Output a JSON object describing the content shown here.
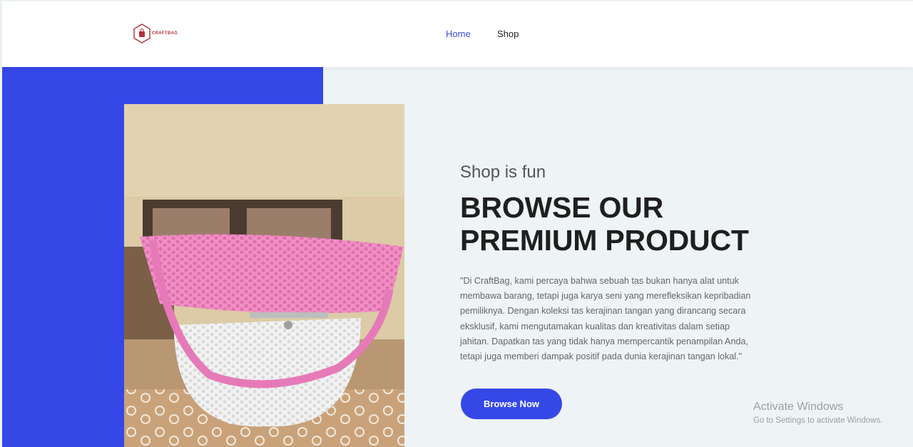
{
  "header": {
    "logo_text": "CRAFTBAG",
    "nav": [
      {
        "label": "Home",
        "active": true
      },
      {
        "label": "Shop",
        "active": false
      }
    ]
  },
  "hero": {
    "subtitle": "Shop is fun",
    "headline_line1": "BROWSE OUR",
    "headline_line2": "PREMIUM PRODUCT",
    "description": "\"Di CraftBag, kami percaya bahwa sebuah tas bukan hanya alat untuk membawa barang, tetapi juga karya seni yang merefleksikan kepribadian pemiliknya. Dengan koleksi tas kerajinan tangan yang dirancang secara eksklusif, kami mengutamakan kualitas dan kreativitas dalam setiap jahitan. Dapatkan tas yang tidak hanya mempercantik penampilan Anda, tetapi juga memberi dampak positif pada dunia kerajinan tangan lokal.\"",
    "cta_label": "Browse Now"
  },
  "watermark": {
    "title": "Activate Windows",
    "subtitle": "Go to Settings to activate Windows."
  },
  "colors": {
    "accent": "#3647e8",
    "logo": "#b0303a"
  },
  "icons": {
    "logo": "shopping-bag-hexagon-icon"
  }
}
